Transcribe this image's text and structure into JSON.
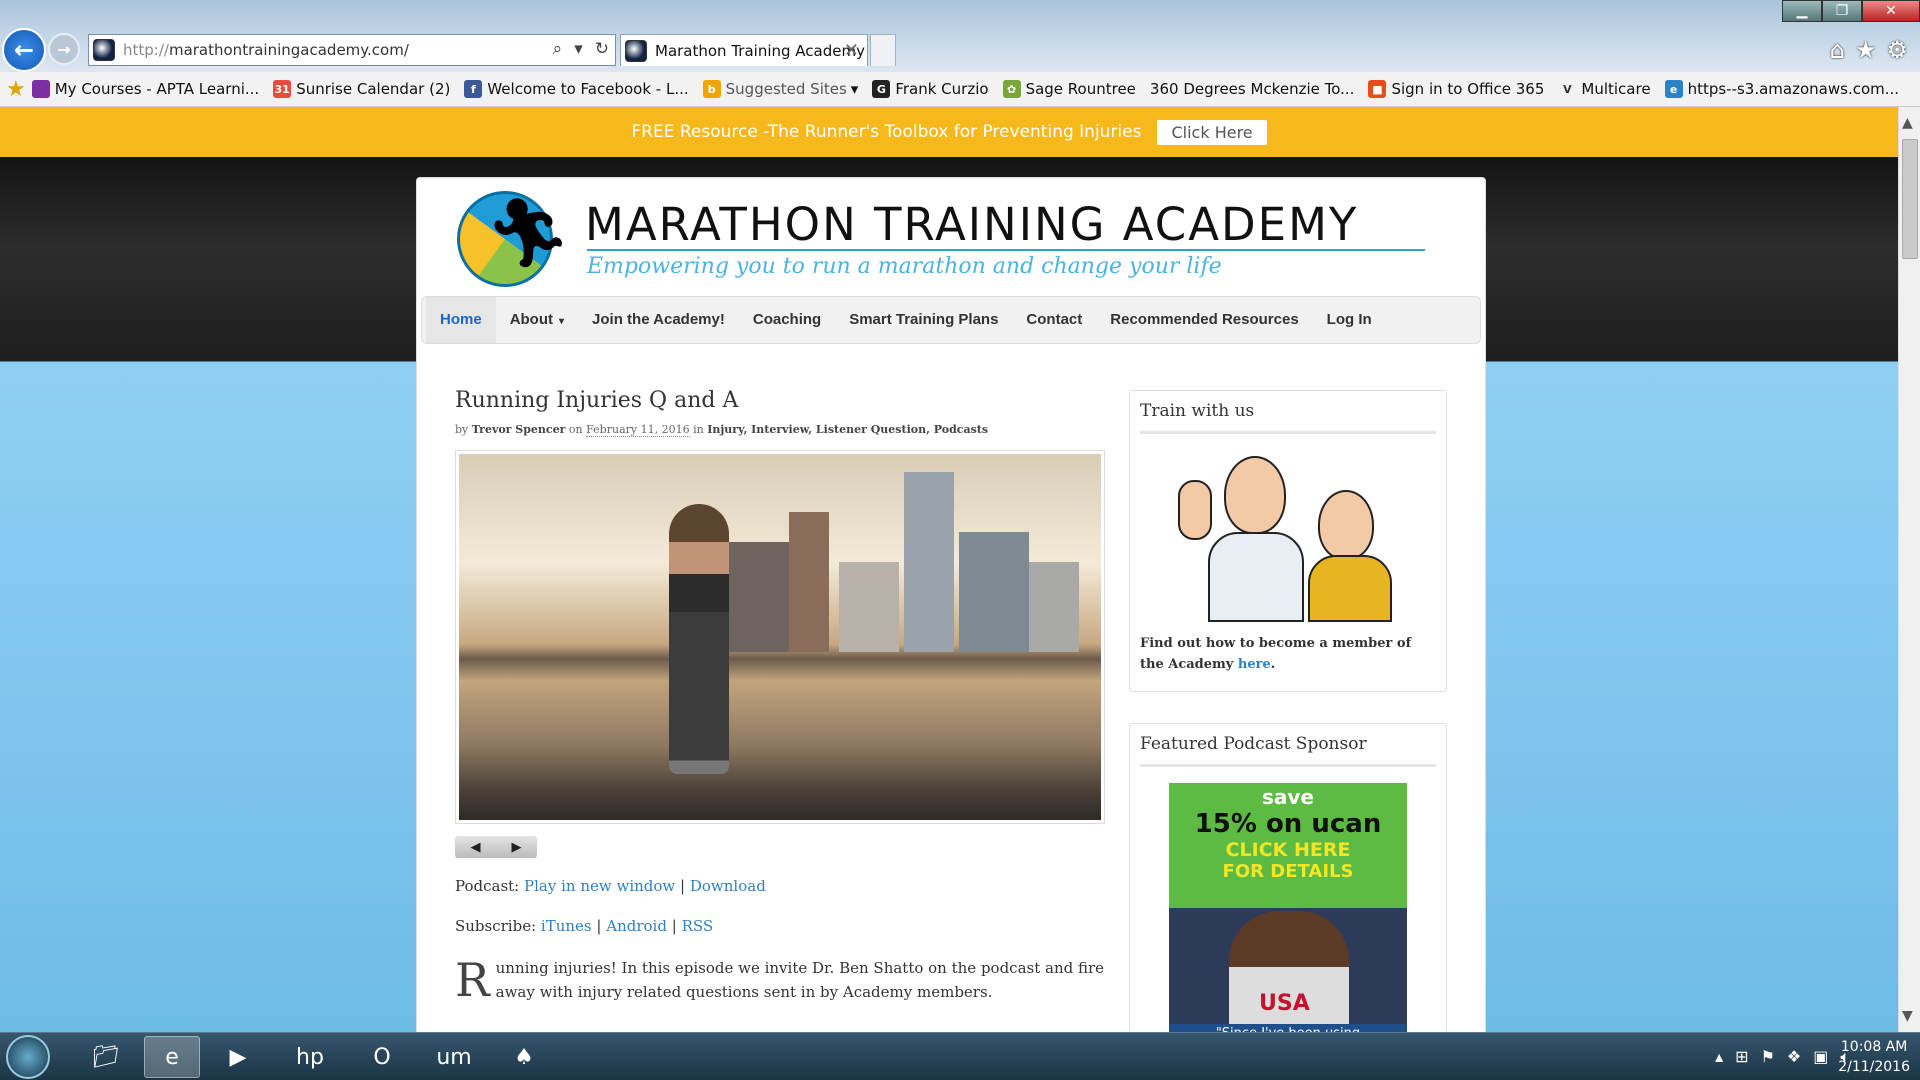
{
  "browser": {
    "url_prefix": "http://",
    "url_rest": "marathontrainingacademy.com/",
    "tab_title": "Marathon Training Academy",
    "favorites": [
      {
        "label": "My Courses - APTA Learni...",
        "color": "#7b2fa3",
        "glyph": ""
      },
      {
        "label": "Sunrise Calendar (2)",
        "color": "#e74c3c",
        "glyph": "31"
      },
      {
        "label": "Welcome to Facebook - L...",
        "color": "#3b5998",
        "glyph": "f"
      },
      {
        "label": "Suggested Sites",
        "color": "#f0a500",
        "glyph": "b",
        "dropdown": "▾"
      },
      {
        "label": "Frank Curzio",
        "color": "#222",
        "glyph": "G"
      },
      {
        "label": "Sage Rountree",
        "color": "#7aa53a",
        "glyph": "✿"
      },
      {
        "label": "360 Degrees Mckenzie  To...",
        "color": "",
        "glyph": ""
      },
      {
        "label": "Sign in to Office 365",
        "color": "#e74c1c",
        "glyph": "■"
      },
      {
        "label": "Multicare",
        "color": "",
        "glyph": "V"
      },
      {
        "label": "https--s3.amazonaws.com...",
        "color": "#2c82c9",
        "glyph": "e"
      }
    ]
  },
  "promo": {
    "text": "FREE Resource -The Runner's Toolbox for Preventing Injuries",
    "button": "Click Here"
  },
  "site": {
    "title": "MARATHON TRAINING ACADEMY",
    "tagline": "Empowering you to run a marathon and change your life"
  },
  "nav": [
    {
      "label": "Home",
      "active": true
    },
    {
      "label": "About",
      "dropdown": "▾"
    },
    {
      "label": "Join the Academy!"
    },
    {
      "label": "Coaching"
    },
    {
      "label": "Smart Training Plans"
    },
    {
      "label": "Contact"
    },
    {
      "label": "Recommended Resources"
    },
    {
      "label": "Log In"
    }
  ],
  "post": {
    "title": "Running Injuries Q and A",
    "by": "by",
    "author": "Trevor Spencer",
    "on": "on",
    "date": "February 11, 2016",
    "in": "in",
    "categories": "Injury, Interview, Listener Question, Podcasts",
    "podcast_label": "Podcast:",
    "play_link": "Play in new window",
    "download_link": "Download",
    "subscribe_label": "Subscribe:",
    "itunes": "iTunes",
    "android": "Android",
    "rss": "RSS",
    "sep": "|",
    "dropcap": "R",
    "intro": "unning injuries! In this episode we invite Dr. Ben Shatto on the podcast and fire away with injury related questions sent in by Academy members."
  },
  "sidebar": {
    "train_title": "Train with us",
    "train_text": "Find out how to become a member of the Academy",
    "train_link": "here",
    "train_period": ".",
    "sponsor_title": "Featured Podcast Sponsor",
    "ad_line1": "save",
    "ad_line2": "15% on ucan",
    "ad_line3": "CLICK HERE",
    "ad_line4": "FOR DETAILS",
    "ad_usa": "USA",
    "ad_quote": "\"Since I've been using"
  },
  "taskbar": {
    "time": "10:08 AM",
    "date": "2/11/2016"
  }
}
